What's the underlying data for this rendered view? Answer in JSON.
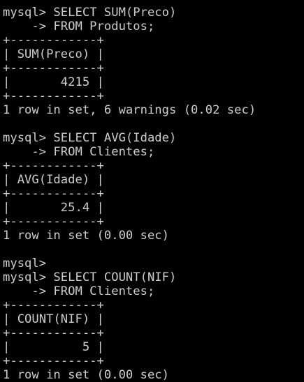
{
  "terminal": {
    "lines": [
      "mysql> SELECT SUM(Preco)",
      "    -> FROM Produtos;",
      "+------------+",
      "| SUM(Preco) |",
      "+------------+",
      "|       4215 |",
      "+------------+",
      "1 row in set, 6 warnings (0.02 sec)",
      "",
      "mysql> SELECT AVG(Idade)",
      "    -> FROM Clientes;",
      "+------------+",
      "| AVG(Idade) |",
      "+------------+",
      "|       25.4 |",
      "+------------+",
      "1 row in set (0.00 sec)",
      "",
      "mysql>",
      "mysql> SELECT COUNT(NIF)",
      "    -> FROM Clientes;",
      "+------------+",
      "| COUNT(NIF) |",
      "+------------+",
      "|          5 |",
      "+------------+",
      "1 row in set (0.00 sec)"
    ]
  }
}
